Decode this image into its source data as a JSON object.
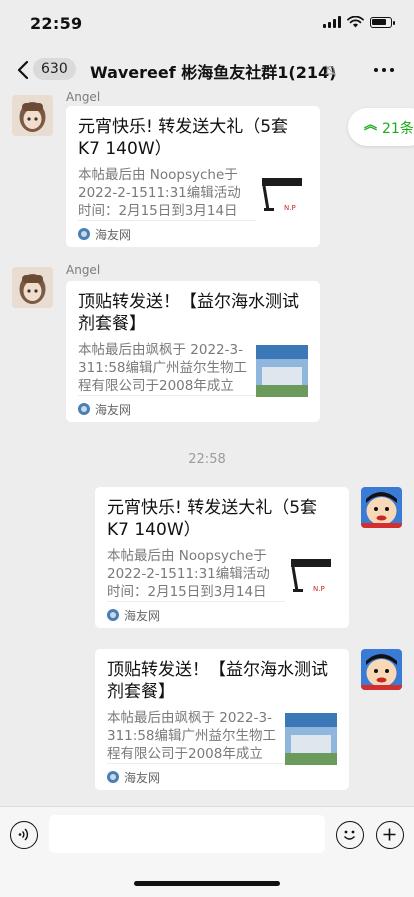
{
  "status_bar": {
    "time": "22:59"
  },
  "nav": {
    "back_count": "630",
    "title": "Wavereef 彬海鱼友社群1(214)"
  },
  "unread": {
    "label": "21条"
  },
  "timestamp": "22:58",
  "messages": [
    {
      "sender": "Angel",
      "side": "left",
      "title": "元宵快乐! 转发送大礼（5套K7  140W）",
      "desc": "本帖最后由 Noopsyche于 2022-2-1511:31编辑活动时间：2月15日到3月14日",
      "source": "海友网",
      "thumb": "lamp-icon"
    },
    {
      "sender": "Angel",
      "side": "left",
      "title": "顶贴转发送！【益尔海水测试剂套餐】",
      "desc": "本帖最后由飒枫于 2022-3-311:58编辑广州益尔生物工程有限公司于2008年成立",
      "source": "海友网",
      "thumb": "building-icon"
    },
    {
      "side": "right",
      "title": "元宵快乐! 转发送大礼（5套K7  140W）",
      "desc": "本帖最后由 Noopsyche于 2022-2-1511:31编辑活动时间：2月15日到3月14日",
      "source": "海友网",
      "thumb": "lamp-icon"
    },
    {
      "side": "right",
      "title": "顶贴转发送！【益尔海水测试剂套餐】",
      "desc": "本帖最后由飒枫于 2022-3-311:58编辑广州益尔生物工程有限公司于2008年成立",
      "source": "海友网",
      "thumb": "building-icon"
    }
  ],
  "colors": {
    "accent": "#1aad19",
    "background": "#ededed",
    "card": "#ffffff"
  }
}
